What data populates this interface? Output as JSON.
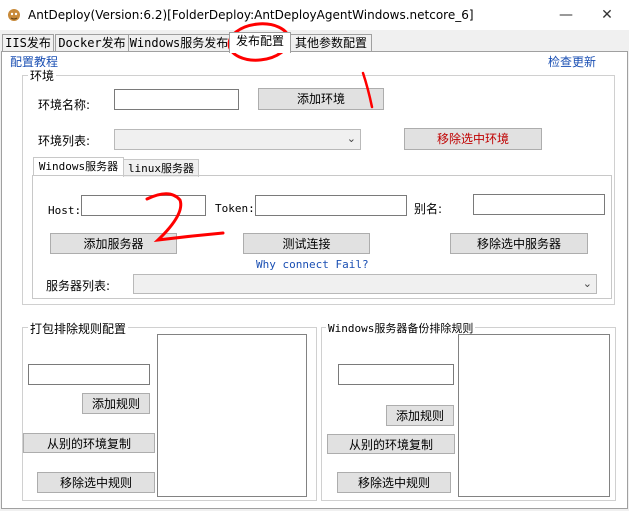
{
  "window": {
    "title": "AntDeploy(Version:6.2)[FolderDeploy:AntDeployAgentWindows.netcore_6]",
    "minimize_icon": "minimize-icon",
    "close_icon": "close-icon",
    "minimize_glyph": "—",
    "close_glyph": "✕"
  },
  "tabs": [
    {
      "label": "IIS发布"
    },
    {
      "label": "Docker发布"
    },
    {
      "label": "Windows服务发布"
    },
    {
      "label": "发布配置"
    },
    {
      "label": "其他参数配置"
    }
  ],
  "links": {
    "tutorial": "配置教程",
    "check_update": "检查更新"
  },
  "env": {
    "group_label": "环境",
    "name_label": "环境名称:",
    "name_value": "",
    "add_button": "添加环境",
    "list_label": "环境列表:",
    "list_value": "",
    "remove_button": "移除选中环境"
  },
  "server_tabs": [
    {
      "label": "Windows服务器"
    },
    {
      "label": "linux服务器"
    }
  ],
  "server": {
    "host_label": "Host:",
    "host_value": "",
    "token_label": "Token:",
    "token_value": "",
    "alias_label": "别名:",
    "alias_value": "",
    "add_button": "添加服务器",
    "test_button": "测试连接",
    "remove_button": "移除选中服务器",
    "fail_link": "Why connect Fail?",
    "list_label": "服务器列表:",
    "list_value": ""
  },
  "pack_rules": {
    "group_label": "打包排除规则配置",
    "input_value": "",
    "add_button": "添加规则",
    "copy_button": "从别的环境复制",
    "remove_button": "移除选中规则"
  },
  "backup_rules": {
    "group_label": "Windows服务器备份排除规则",
    "input_value": "",
    "add_button": "添加规则",
    "copy_button": "从别的环境复制",
    "remove_button": "移除选中规则"
  },
  "annotations": {
    "number_1": "1",
    "number_2": "2",
    "color": "#ff0000"
  },
  "colors": {
    "link": "#1a4fb3",
    "danger_text": "#c00000"
  }
}
